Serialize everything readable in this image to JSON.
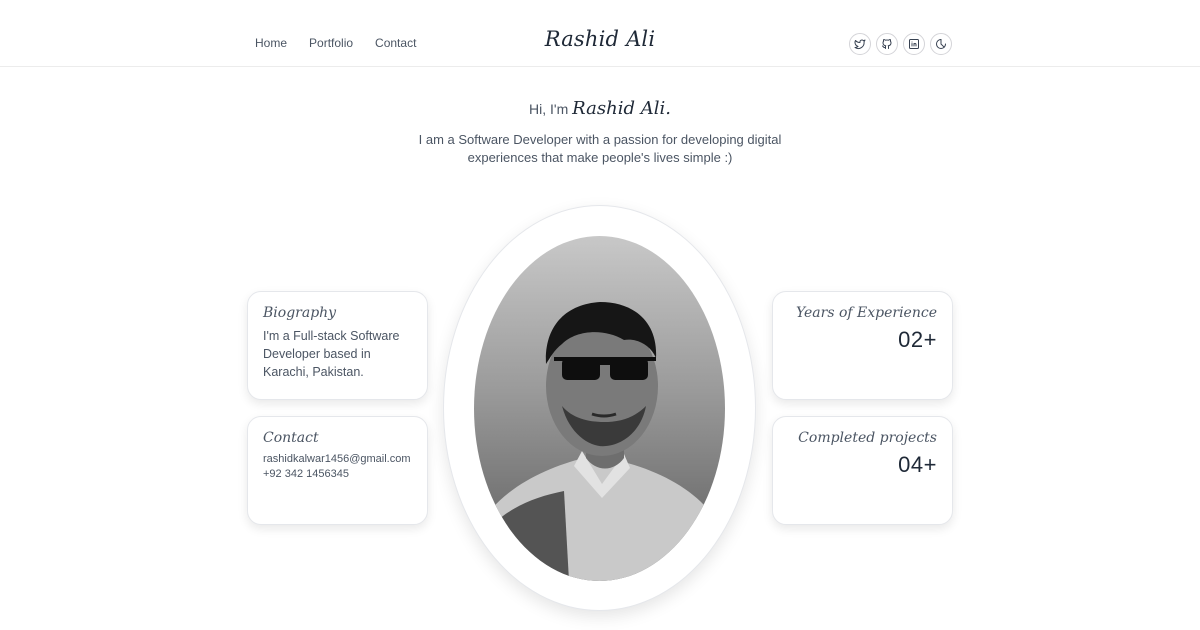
{
  "header": {
    "nav": [
      "Home",
      "Portfolio",
      "Contact"
    ],
    "logo": "Rashid Ali",
    "social_icons": [
      "twitter-icon",
      "github-icon",
      "linkedin-icon",
      "theme-toggle-icon"
    ]
  },
  "hero": {
    "greeting_prefix": "Hi, I'm",
    "greeting_name": "Rashid Ali.",
    "tagline": "I am a Software Developer with a passion for developing digital experiences that make people's lives simple :)"
  },
  "cards": {
    "biography": {
      "title": "Biography",
      "text": "I'm a Full-stack Software Developer based in Karachi, Pakistan."
    },
    "contact": {
      "title": "Contact",
      "email": "rashidkalwar1456@gmail.com",
      "phone": "+92 342 1456345"
    },
    "experience": {
      "title": "Years of Experience",
      "value": "02+"
    },
    "projects": {
      "title": "Completed projects",
      "value": "04+"
    }
  },
  "colors": {
    "text": "#374151",
    "heading": "#1f2937",
    "border": "#e5e7eb"
  }
}
